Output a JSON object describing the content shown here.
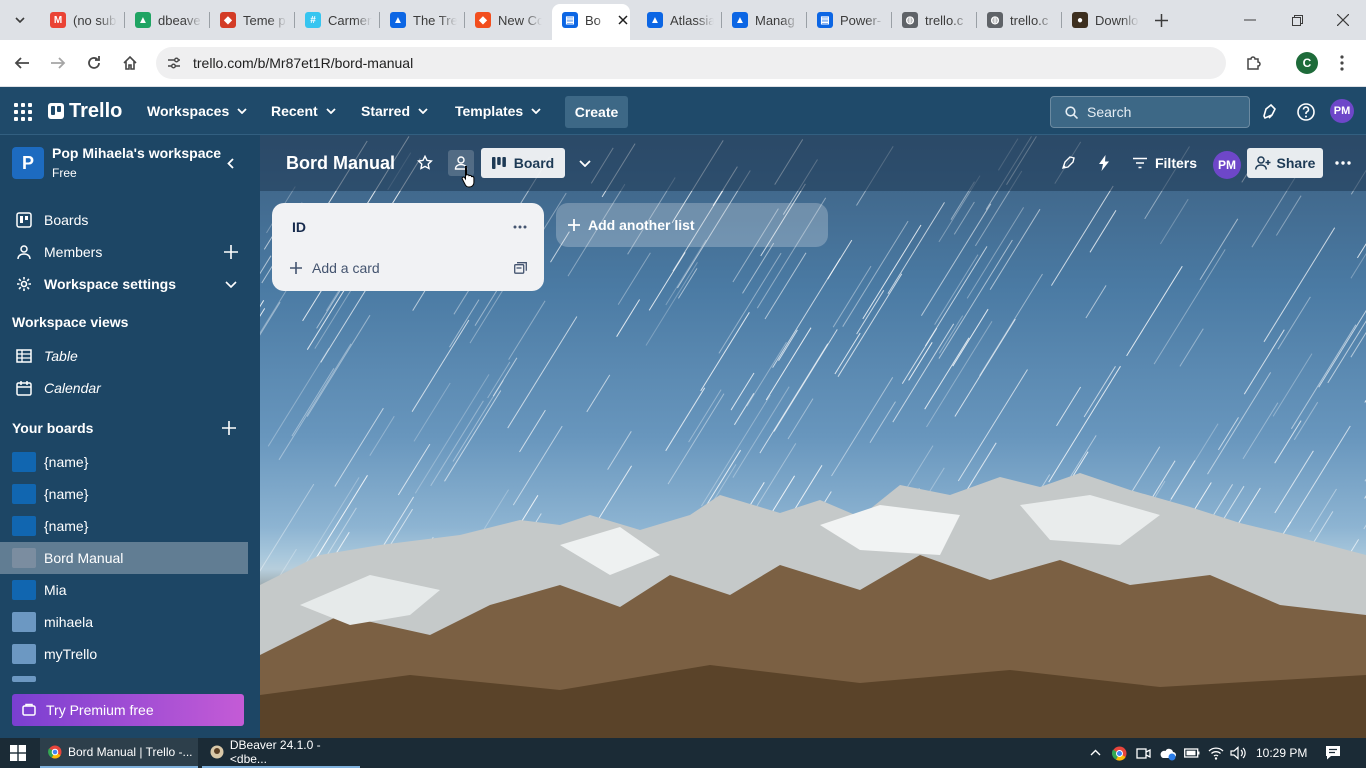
{
  "browser": {
    "tabs": [
      {
        "label": "(no sub",
        "icon": "gmail-icon",
        "color": "#ea4335"
      },
      {
        "label": "dbeave",
        "icon": "google-drive-icon",
        "color": "#1fa463"
      },
      {
        "label": "Teme p",
        "icon": "tab-site-icon",
        "color": "#d33c26"
      },
      {
        "label": "Carmen",
        "icon": "slack-icon",
        "color": "#36c5f0"
      },
      {
        "label": "The Tre",
        "icon": "atlassian-icon",
        "color": "#0c66e4"
      },
      {
        "label": "New Co",
        "icon": "tab-site-icon",
        "color": "#f24e1e"
      },
      {
        "label": "Bo",
        "icon": "trello-icon",
        "color": "#0c66e4"
      },
      {
        "label": "Atlassia",
        "icon": "atlassian-icon",
        "color": "#0c66e4"
      },
      {
        "label": "Manag",
        "icon": "atlassian-icon",
        "color": "#0c66e4"
      },
      {
        "label": "Power-",
        "icon": "trello-icon",
        "color": "#0c66e4"
      },
      {
        "label": "trello.c",
        "icon": "globe-icon",
        "color": "#5f6368"
      },
      {
        "label": "trello.c",
        "icon": "globe-icon",
        "color": "#5f6368"
      },
      {
        "label": "Downlo",
        "icon": "dbeaver-icon",
        "color": "#3d2f1f"
      }
    ],
    "url": "trello.com/b/Mr87et1R/bord-manual",
    "profile_initial": "C"
  },
  "header": {
    "logo_text": "Trello",
    "nav": [
      "Workspaces",
      "Recent",
      "Starred",
      "Templates"
    ],
    "create_label": "Create",
    "search_placeholder": "Search",
    "avatar_initials": "PM"
  },
  "sidebar": {
    "workspace_initial": "P",
    "workspace_name": "Pop Mihaela's workspace",
    "workspace_plan": "Free",
    "items": [
      {
        "label": "Boards"
      },
      {
        "label": "Members"
      },
      {
        "label": "Workspace settings"
      }
    ],
    "views_heading": "Workspace views",
    "views": [
      {
        "label": "Table"
      },
      {
        "label": "Calendar"
      }
    ],
    "boards_heading": "Your boards",
    "boards": [
      {
        "label": "{name}",
        "color": "#1166b0"
      },
      {
        "label": "{name}",
        "color": "#1166b0"
      },
      {
        "label": "{name}",
        "color": "#1166b0"
      },
      {
        "label": "Bord Manual",
        "color": "#7b8da0"
      },
      {
        "label": "Mia",
        "color": "#1166b0"
      },
      {
        "label": "mihaela",
        "color": "#6c98c2"
      },
      {
        "label": "myTrello",
        "color": "#6c98c2"
      }
    ],
    "premium_label": "Try Premium free"
  },
  "board": {
    "title": "Bord Manual",
    "view_label": "Board",
    "filters_label": "Filters",
    "avatar_initials": "PM",
    "share_label": "Share",
    "lists": [
      {
        "title": "ID",
        "add_card_label": "Add a card"
      }
    ],
    "add_list_label": "Add another list"
  },
  "taskbar": {
    "apps": [
      {
        "label": "Bord Manual | Trello -..."
      },
      {
        "label": "DBeaver 24.1.0 - <dbe..."
      }
    ],
    "time": "10:29 PM"
  }
}
